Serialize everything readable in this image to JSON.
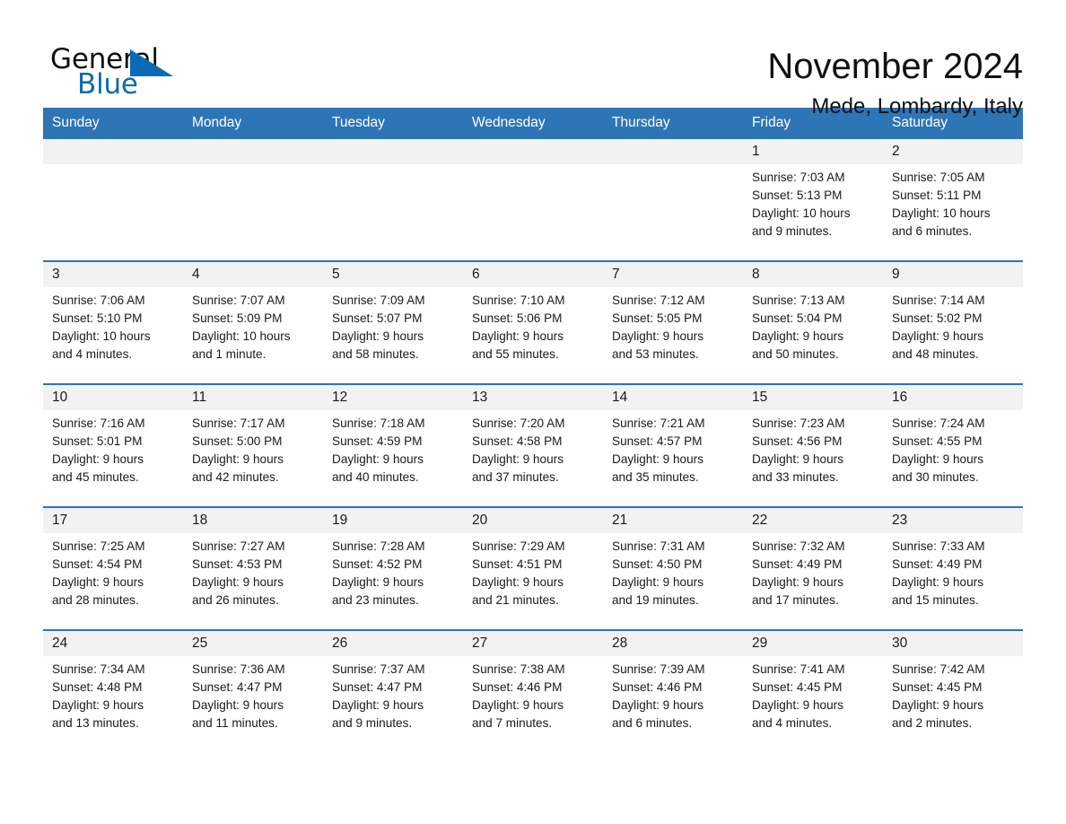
{
  "brand": {
    "word_one": "General",
    "word_two": "Blue",
    "triangle_icon": "blue-triangle-logo-mark",
    "accent_color": "#0a6ab5"
  },
  "header": {
    "title": "November 2024",
    "subtitle": "Mede, Lombardy, Italy"
  },
  "colors": {
    "header_blue": "#2e75b6",
    "day_number_band": "#f2f2f2",
    "text": "#1a1a1a"
  },
  "calendar": {
    "weekdays": [
      "Sunday",
      "Monday",
      "Tuesday",
      "Wednesday",
      "Thursday",
      "Friday",
      "Saturday"
    ],
    "weeks": [
      [
        {
          "day": "",
          "lines": []
        },
        {
          "day": "",
          "lines": []
        },
        {
          "day": "",
          "lines": []
        },
        {
          "day": "",
          "lines": []
        },
        {
          "day": "",
          "lines": []
        },
        {
          "day": "1",
          "lines": [
            "Sunrise: 7:03 AM",
            "Sunset: 5:13 PM",
            "Daylight: 10 hours",
            "and 9 minutes."
          ]
        },
        {
          "day": "2",
          "lines": [
            "Sunrise: 7:05 AM",
            "Sunset: 5:11 PM",
            "Daylight: 10 hours",
            "and 6 minutes."
          ]
        }
      ],
      [
        {
          "day": "3",
          "lines": [
            "Sunrise: 7:06 AM",
            "Sunset: 5:10 PM",
            "Daylight: 10 hours",
            "and 4 minutes."
          ]
        },
        {
          "day": "4",
          "lines": [
            "Sunrise: 7:07 AM",
            "Sunset: 5:09 PM",
            "Daylight: 10 hours",
            "and 1 minute."
          ]
        },
        {
          "day": "5",
          "lines": [
            "Sunrise: 7:09 AM",
            "Sunset: 5:07 PM",
            "Daylight: 9 hours",
            "and 58 minutes."
          ]
        },
        {
          "day": "6",
          "lines": [
            "Sunrise: 7:10 AM",
            "Sunset: 5:06 PM",
            "Daylight: 9 hours",
            "and 55 minutes."
          ]
        },
        {
          "day": "7",
          "lines": [
            "Sunrise: 7:12 AM",
            "Sunset: 5:05 PM",
            "Daylight: 9 hours",
            "and 53 minutes."
          ]
        },
        {
          "day": "8",
          "lines": [
            "Sunrise: 7:13 AM",
            "Sunset: 5:04 PM",
            "Daylight: 9 hours",
            "and 50 minutes."
          ]
        },
        {
          "day": "9",
          "lines": [
            "Sunrise: 7:14 AM",
            "Sunset: 5:02 PM",
            "Daylight: 9 hours",
            "and 48 minutes."
          ]
        }
      ],
      [
        {
          "day": "10",
          "lines": [
            "Sunrise: 7:16 AM",
            "Sunset: 5:01 PM",
            "Daylight: 9 hours",
            "and 45 minutes."
          ]
        },
        {
          "day": "11",
          "lines": [
            "Sunrise: 7:17 AM",
            "Sunset: 5:00 PM",
            "Daylight: 9 hours",
            "and 42 minutes."
          ]
        },
        {
          "day": "12",
          "lines": [
            "Sunrise: 7:18 AM",
            "Sunset: 4:59 PM",
            "Daylight: 9 hours",
            "and 40 minutes."
          ]
        },
        {
          "day": "13",
          "lines": [
            "Sunrise: 7:20 AM",
            "Sunset: 4:58 PM",
            "Daylight: 9 hours",
            "and 37 minutes."
          ]
        },
        {
          "day": "14",
          "lines": [
            "Sunrise: 7:21 AM",
            "Sunset: 4:57 PM",
            "Daylight: 9 hours",
            "and 35 minutes."
          ]
        },
        {
          "day": "15",
          "lines": [
            "Sunrise: 7:23 AM",
            "Sunset: 4:56 PM",
            "Daylight: 9 hours",
            "and 33 minutes."
          ]
        },
        {
          "day": "16",
          "lines": [
            "Sunrise: 7:24 AM",
            "Sunset: 4:55 PM",
            "Daylight: 9 hours",
            "and 30 minutes."
          ]
        }
      ],
      [
        {
          "day": "17",
          "lines": [
            "Sunrise: 7:25 AM",
            "Sunset: 4:54 PM",
            "Daylight: 9 hours",
            "and 28 minutes."
          ]
        },
        {
          "day": "18",
          "lines": [
            "Sunrise: 7:27 AM",
            "Sunset: 4:53 PM",
            "Daylight: 9 hours",
            "and 26 minutes."
          ]
        },
        {
          "day": "19",
          "lines": [
            "Sunrise: 7:28 AM",
            "Sunset: 4:52 PM",
            "Daylight: 9 hours",
            "and 23 minutes."
          ]
        },
        {
          "day": "20",
          "lines": [
            "Sunrise: 7:29 AM",
            "Sunset: 4:51 PM",
            "Daylight: 9 hours",
            "and 21 minutes."
          ]
        },
        {
          "day": "21",
          "lines": [
            "Sunrise: 7:31 AM",
            "Sunset: 4:50 PM",
            "Daylight: 9 hours",
            "and 19 minutes."
          ]
        },
        {
          "day": "22",
          "lines": [
            "Sunrise: 7:32 AM",
            "Sunset: 4:49 PM",
            "Daylight: 9 hours",
            "and 17 minutes."
          ]
        },
        {
          "day": "23",
          "lines": [
            "Sunrise: 7:33 AM",
            "Sunset: 4:49 PM",
            "Daylight: 9 hours",
            "and 15 minutes."
          ]
        }
      ],
      [
        {
          "day": "24",
          "lines": [
            "Sunrise: 7:34 AM",
            "Sunset: 4:48 PM",
            "Daylight: 9 hours",
            "and 13 minutes."
          ]
        },
        {
          "day": "25",
          "lines": [
            "Sunrise: 7:36 AM",
            "Sunset: 4:47 PM",
            "Daylight: 9 hours",
            "and 11 minutes."
          ]
        },
        {
          "day": "26",
          "lines": [
            "Sunrise: 7:37 AM",
            "Sunset: 4:47 PM",
            "Daylight: 9 hours",
            "and 9 minutes."
          ]
        },
        {
          "day": "27",
          "lines": [
            "Sunrise: 7:38 AM",
            "Sunset: 4:46 PM",
            "Daylight: 9 hours",
            "and 7 minutes."
          ]
        },
        {
          "day": "28",
          "lines": [
            "Sunrise: 7:39 AM",
            "Sunset: 4:46 PM",
            "Daylight: 9 hours",
            "and 6 minutes."
          ]
        },
        {
          "day": "29",
          "lines": [
            "Sunrise: 7:41 AM",
            "Sunset: 4:45 PM",
            "Daylight: 9 hours",
            "and 4 minutes."
          ]
        },
        {
          "day": "30",
          "lines": [
            "Sunrise: 7:42 AM",
            "Sunset: 4:45 PM",
            "Daylight: 9 hours",
            "and 2 minutes."
          ]
        }
      ]
    ]
  }
}
